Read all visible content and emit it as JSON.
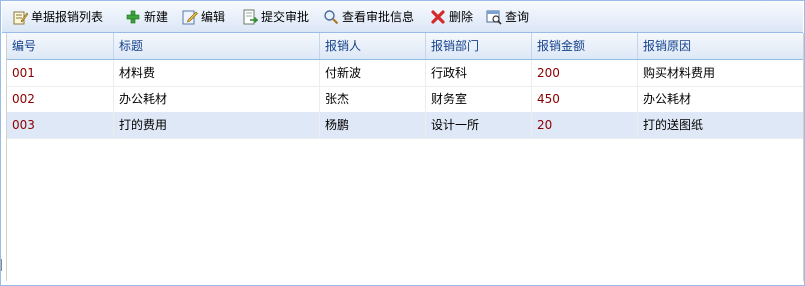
{
  "toolbar": {
    "title": "单据报销列表",
    "new_label": "新建",
    "edit_label": "编辑",
    "submit_label": "提交审批",
    "view_label": "查看审批信息",
    "delete_label": "删除",
    "query_label": "查询"
  },
  "grid": {
    "columns": [
      "编号",
      "标题",
      "报销人",
      "报销部门",
      "报销金额",
      "报销原因"
    ],
    "rows": [
      {
        "id": "001",
        "title": "材料费",
        "person": "付新波",
        "dept": "行政科",
        "amount": "200",
        "reason": "购买材料费用"
      },
      {
        "id": "002",
        "title": "办公耗材",
        "person": "张杰",
        "dept": "财务室",
        "amount": "450",
        "reason": "办公耗材"
      },
      {
        "id": "003",
        "title": "打的费用",
        "person": "杨鹏",
        "dept": "设计一所",
        "amount": "20",
        "reason": "打的送图纸"
      }
    ],
    "selected_row": 3
  },
  "colors": {
    "accent_border": "#99bbe8",
    "header_text": "#15428b",
    "selected_row": "#dfe8f6",
    "value_red": "#8b0000"
  },
  "icons": {
    "title": "list-edit-icon",
    "new": "green-plus-icon",
    "edit": "edit-pencil-icon",
    "submit": "submit-document-icon",
    "view": "magnifier-icon",
    "delete": "red-x-icon",
    "query": "query-window-icon"
  }
}
